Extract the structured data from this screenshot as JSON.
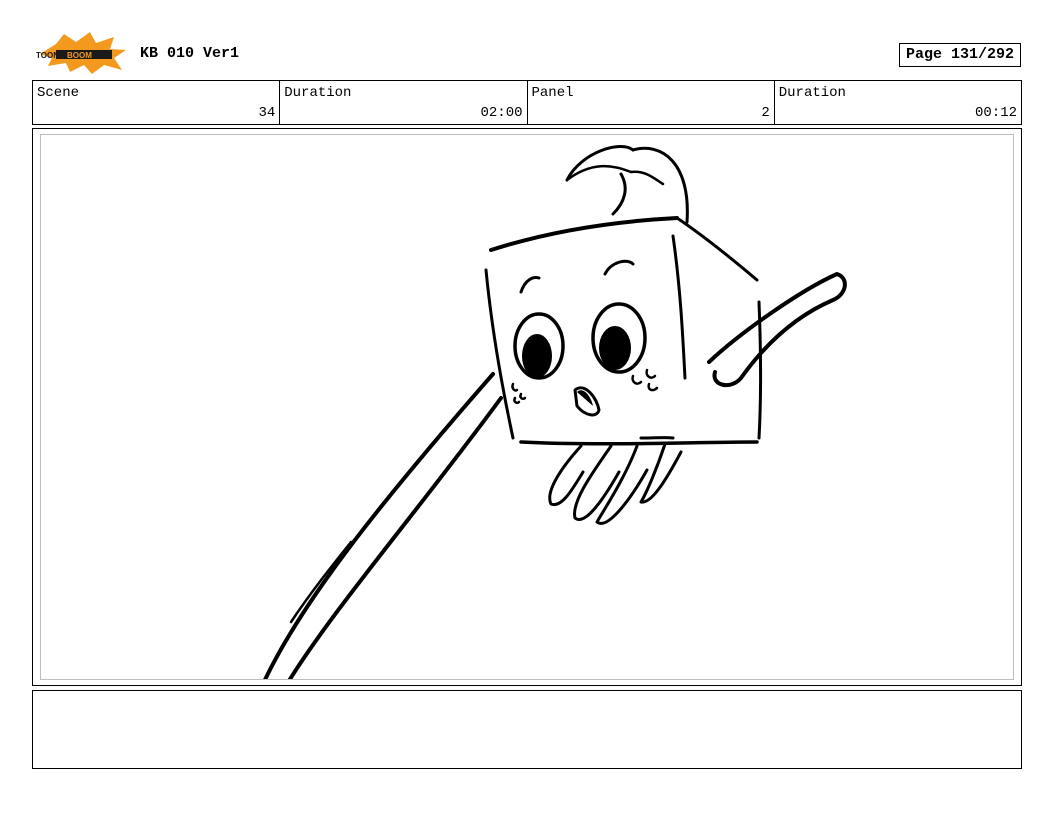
{
  "header": {
    "logo_text": "TOON BOOM",
    "project_title": "KB 010 Ver1",
    "page_label": "Page 131/292"
  },
  "info": {
    "scene_label": "Scene",
    "scene_value": "34",
    "scene_duration_label": "Duration",
    "scene_duration_value": "02:00",
    "panel_label": "Panel",
    "panel_value": "2",
    "panel_duration_label": "Duration",
    "panel_duration_value": "00:12"
  },
  "colors": {
    "logo_burst": "#f39a1e",
    "logo_band": "#1a1a1a",
    "panel_inner_border": "#bdbdbd"
  },
  "notes": {
    "text": ""
  }
}
